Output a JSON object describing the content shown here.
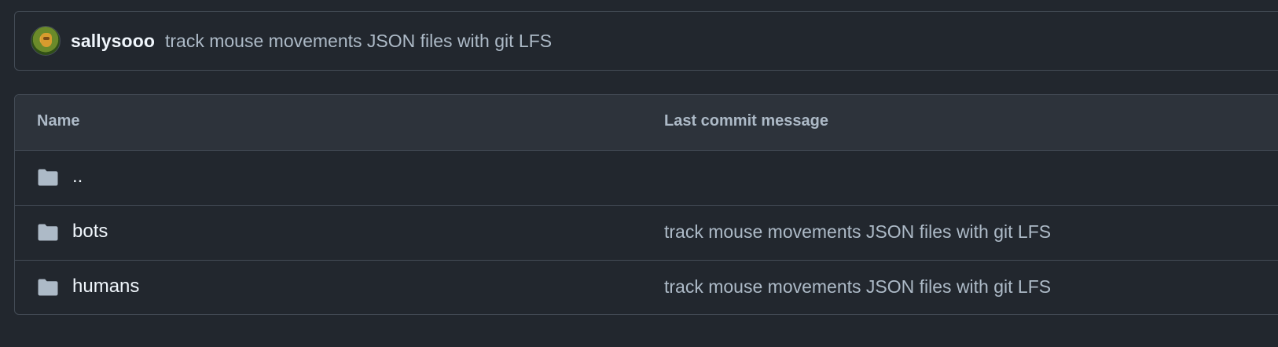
{
  "commit": {
    "author": "sallysooo",
    "message": "track mouse movements JSON files with git LFS"
  },
  "table": {
    "headers": {
      "name": "Name",
      "last_commit_message": "Last commit message"
    },
    "rows": [
      {
        "name": "..",
        "message": ""
      },
      {
        "name": "bots",
        "message": "track mouse movements JSON files with git LFS"
      },
      {
        "name": "humans",
        "message": "track mouse movements JSON files with git LFS"
      }
    ]
  },
  "icons": {
    "row_icon": "folder-icon",
    "avatar": "avatar"
  },
  "colors": {
    "background": "#22272e",
    "border": "#444c56",
    "header_bg": "#2d333b",
    "primary_text": "#f0f6fc",
    "secondary_text": "#adbac7",
    "folder_icon": "#adbac7"
  }
}
